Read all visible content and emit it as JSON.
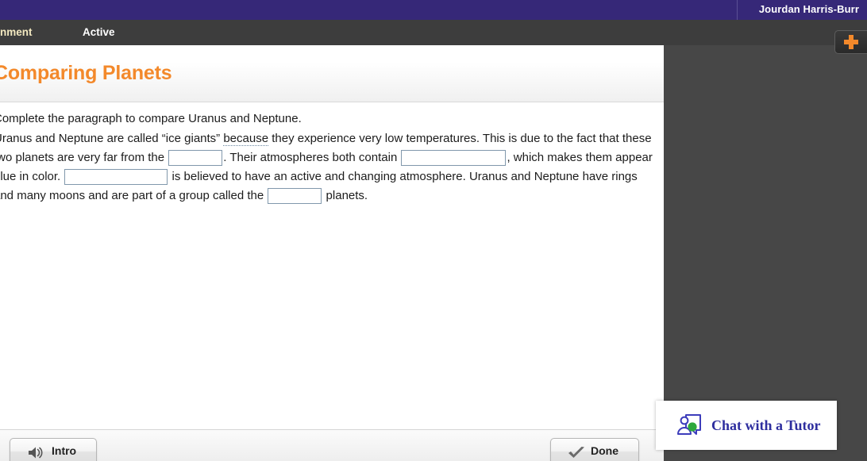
{
  "top_bar": {
    "user_name": "Jourdan Harris-Burr",
    "background_color": "#362878"
  },
  "tab_bar": {
    "tabs": [
      {
        "label": "ssignment",
        "active": true,
        "color": "#f2e8c0"
      },
      {
        "label": "Active",
        "active": false,
        "color": "#ffffff"
      }
    ]
  },
  "add_button": {
    "icon": "plus-icon",
    "color": "#f3892b"
  },
  "lesson": {
    "title": "Comparing Planets",
    "title_color": "#f3892b",
    "prompt": "Complete the paragraph to compare Uranus and Neptune.",
    "paragraph": {
      "seg1": "Uranus and Neptune are called “ice giants” ",
      "gloss1": "because",
      "seg2": " they experience very low temperatures. This is due to the fact that these two planets are very far from the ",
      "blank1_value": "",
      "seg3": ". Their atmospheres both contain ",
      "blank2_value": "",
      "seg4": ", which makes them appear blue in color. ",
      "blank3_value": "",
      "seg5": " is believed to have an active and changing atmosphere. Uranus and Neptune have rings and many moons and are part of a group called the ",
      "blank4_value": "",
      "seg6": " planets."
    }
  },
  "footer": {
    "intro_label": "Intro",
    "intro_icon": "speaker-icon",
    "done_label": "Done",
    "done_icon": "check-icon"
  },
  "chat_widget": {
    "label": "Chat with a Tutor",
    "icon": "chat-tutor-icon",
    "label_color": "#2d2d9e",
    "status_dot_color": "#2ea83c"
  }
}
